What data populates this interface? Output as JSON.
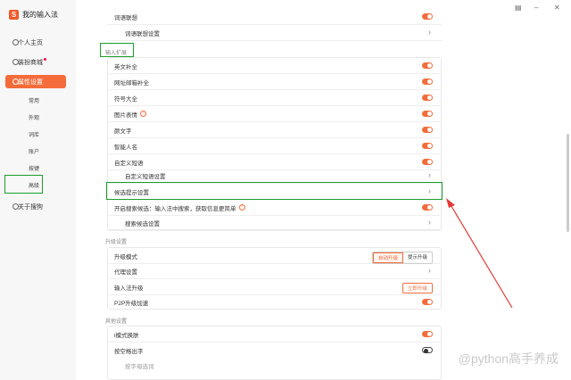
{
  "app": {
    "title": "我的输入法",
    "logo_glyph": "S"
  },
  "window_controls": {
    "menu": "▤",
    "minimize": "–",
    "close": "✕"
  },
  "sidebar": {
    "items": [
      {
        "label": "个人主页",
        "icon": "user-icon"
      },
      {
        "label": "装扮商城",
        "icon": "shop-icon",
        "badge": true
      },
      {
        "label": "属性设置",
        "icon": "settings-icon",
        "active": true
      },
      {
        "label": "关于搜狗",
        "icon": "info-icon"
      }
    ],
    "sub_items": [
      "常用",
      "外观",
      "词库",
      "账户",
      "按键",
      "高级"
    ]
  },
  "main": {
    "top_rows": [
      {
        "label": "词语联想",
        "control": "toggle-on"
      },
      {
        "label": "词语联想设置",
        "control": "chevron"
      }
    ],
    "section_input_ext": "输入扩展",
    "ext_rows": [
      {
        "label": "英文补全",
        "control": "toggle-on"
      },
      {
        "label": "网址邮箱补全",
        "control": "toggle-on"
      },
      {
        "label": "符号大全",
        "control": "toggle-on"
      },
      {
        "label": "图片表情",
        "control": "toggle-on",
        "help": true
      },
      {
        "label": "颜文字",
        "control": "toggle-on"
      },
      {
        "label": "智能人名",
        "control": "toggle-on"
      },
      {
        "label": "自定义短语",
        "control": "toggle-on"
      }
    ],
    "custom_phrase_settings": "自定义短语设置",
    "candidate_tip_settings": "候选提示设置",
    "search_candidate": "开启搜索候选：输入法中搜索，获取信息更简单",
    "search_candidate_settings": "搜索候选设置",
    "section_upgrade": "升级设置",
    "upgrade_mode_label": "升级模式",
    "upgrade_mode_auto": "自动升级",
    "upgrade_mode_prompt": "提示升级",
    "proxy_settings": "代理设置",
    "ime_upgrade_label": "输入法升级",
    "upgrade_now_button": "立即升级",
    "p2p_label": "P2P升级加速",
    "section_other": "其他设置",
    "i_mode_label": "i模式换肤",
    "space_output_label": "按空格出字",
    "space_output_sub": "按字母选词"
  },
  "watermark": "@python高手养成",
  "colors": {
    "accent": "#f46c3a",
    "highlight_box": "#1a9e2a",
    "arrow": "#e53935"
  }
}
